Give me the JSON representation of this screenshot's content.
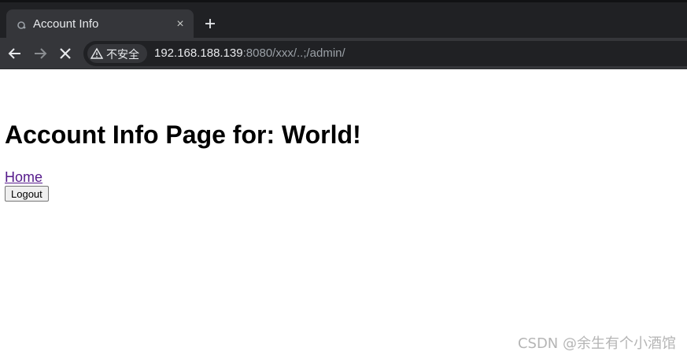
{
  "browser": {
    "tab": {
      "title": "Account Info",
      "close_glyph": "×"
    },
    "new_tab_icon": "plus-icon",
    "address": {
      "security_label": "不安全",
      "url_host": "192.168.188.139",
      "url_rest": ":8080/xxx/..;/admin/"
    },
    "colors": {
      "chrome_dark": "#202124",
      "chrome": "#35363a",
      "text": "#e8eaed"
    }
  },
  "page": {
    "heading": "Account Info Page for: World!",
    "home_link": "Home",
    "logout_button": "Logout",
    "link_color": "#551a8b"
  },
  "watermark": "CSDN @余生有个小酒馆"
}
